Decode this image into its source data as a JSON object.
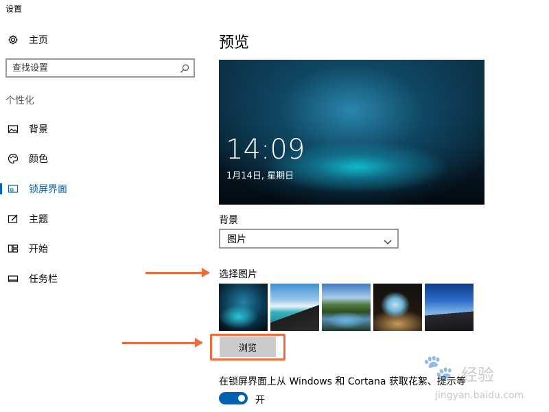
{
  "app_title": "设置",
  "sidebar": {
    "home": {
      "label": "主页",
      "icon": "gear-icon"
    },
    "search": {
      "placeholder": "查找设置",
      "icon": "search-icon"
    },
    "section_header": "个性化",
    "items": [
      {
        "label": "背景",
        "icon": "picture-icon"
      },
      {
        "label": "颜色",
        "icon": "palette-icon"
      },
      {
        "label": "锁屏界面",
        "icon": "lock-screen-icon",
        "active": true
      },
      {
        "label": "主题",
        "icon": "theme-icon"
      },
      {
        "label": "开始",
        "icon": "start-icon"
      },
      {
        "label": "任务栏",
        "icon": "taskbar-icon"
      }
    ]
  },
  "main": {
    "title": "预览",
    "preview": {
      "time": "14:09",
      "date": "1月14日, 星期日"
    },
    "background_label": "背景",
    "background_dropdown": {
      "value": "图片"
    },
    "choose_picture_label": "选择图片",
    "thumbnails": [
      "ice-cave",
      "beach-cliff",
      "mountain-lake",
      "sea-cave",
      "night-coast"
    ],
    "browse_button": "浏览",
    "cortana_label": "在锁屏界面上从 Windows 和 Cortana 获取花絮、提示等",
    "toggle": {
      "state": "开",
      "on": true
    }
  },
  "watermark": {
    "name": "经验",
    "url": "jingyan.baidu.com"
  },
  "colors": {
    "accent": "#0063b1",
    "annotation": "#f26b3a"
  }
}
